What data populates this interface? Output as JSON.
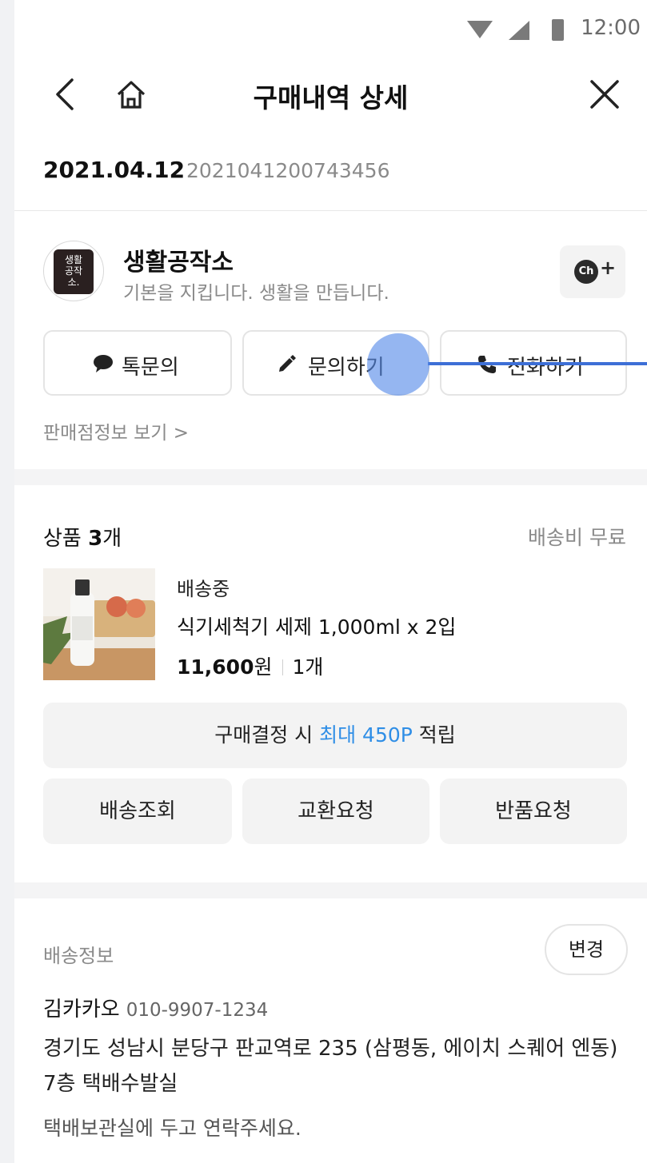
{
  "status_bar": {
    "time": "12:00"
  },
  "nav": {
    "title": "구매내역 상세"
  },
  "order": {
    "date": "2021.04.12",
    "number": "2021041200743456"
  },
  "seller": {
    "logo_text": "생활\n공작\n소.",
    "name": "생활공작소",
    "slogan": "기본을 지킵니다. 생활을 만듭니다.",
    "channel_badge": "Ch",
    "channel_plus": "+",
    "buttons": {
      "talk": "톡문의",
      "inquiry": "문의하기",
      "call": "전화하기"
    },
    "info_link": "판매점정보 보기 >"
  },
  "products": {
    "count_prefix": "상품 ",
    "count_value": "3",
    "count_suffix": "개",
    "shipping_fee": "배송비 무료",
    "item": {
      "status": "배송중",
      "name": "식기세척기 세제 1,000ml x 2입",
      "price": "11,600",
      "currency": "원",
      "qty": "1개"
    },
    "points": {
      "prefix": "구매결정 시 ",
      "highlight": "최대 450P",
      "suffix": " 적립"
    },
    "actions": {
      "track": "배송조회",
      "exchange": "교환요청",
      "return": "반품요청"
    }
  },
  "shipping": {
    "heading": "배송정보",
    "change_label": "변경",
    "recipient": "김카카오",
    "phone": "010-9907-1234",
    "address": "경기도 성남시 분당구 판교역로 235 (삼평동, 에이치 스퀘어 엔동) 7층 택배수발실",
    "memo": "택배보관실에 두고 연락주세요."
  },
  "colors": {
    "accent": "#2f8ee6",
    "touch": "#5489e8"
  }
}
